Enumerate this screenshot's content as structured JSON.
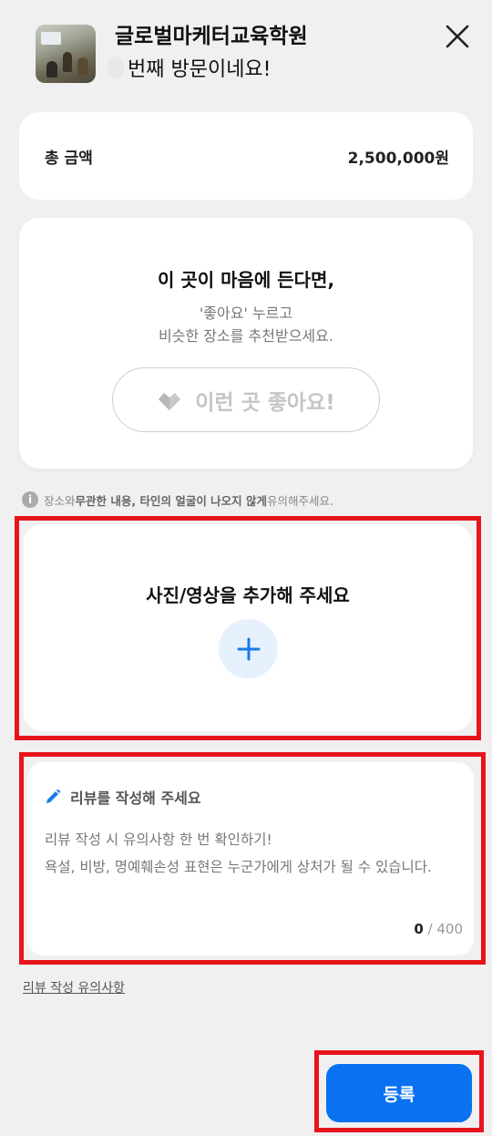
{
  "header": {
    "place_name": "글로벌마케터교육학원",
    "visit_text": "번째 방문이네요!",
    "close_icon": "close-icon"
  },
  "total": {
    "label": "총 금액",
    "value": "2,500,000원"
  },
  "like_card": {
    "title": "이 곳이 마음에 든다면,",
    "subtitle_line1": "'좋아요' 누르고",
    "subtitle_line2": "비슷한 장소를 추천받으세요.",
    "button_label": "이런 곳 좋아요!",
    "button_icon": "heart-icon"
  },
  "notice": {
    "part1": "장소와 ",
    "bold1": "무관한 내용, 타인의 얼굴이 나오지 않게",
    "part2": " 유의해주세요.",
    "icon": "info-icon"
  },
  "photo": {
    "title": "사진/영상을 추가해 주세요",
    "add_icon": "plus-icon"
  },
  "review": {
    "heading": "리뷰를 작성해 주세요",
    "placeholder_line1": "리뷰 작성 시 유의사항 한 번 확인하기!",
    "placeholder_line2": "욕설, 비방, 명예훼손성 표현은 누군가에게 상처가 될 수 있습니다.",
    "count_current": "0",
    "count_max": "/ 400",
    "icon": "pencil-icon"
  },
  "guide_link": "리뷰 작성 유의사항",
  "submit_label": "등록",
  "colors": {
    "accent": "#0a72f0",
    "highlight_frame": "#e8141c",
    "background": "#f0f0f0"
  }
}
